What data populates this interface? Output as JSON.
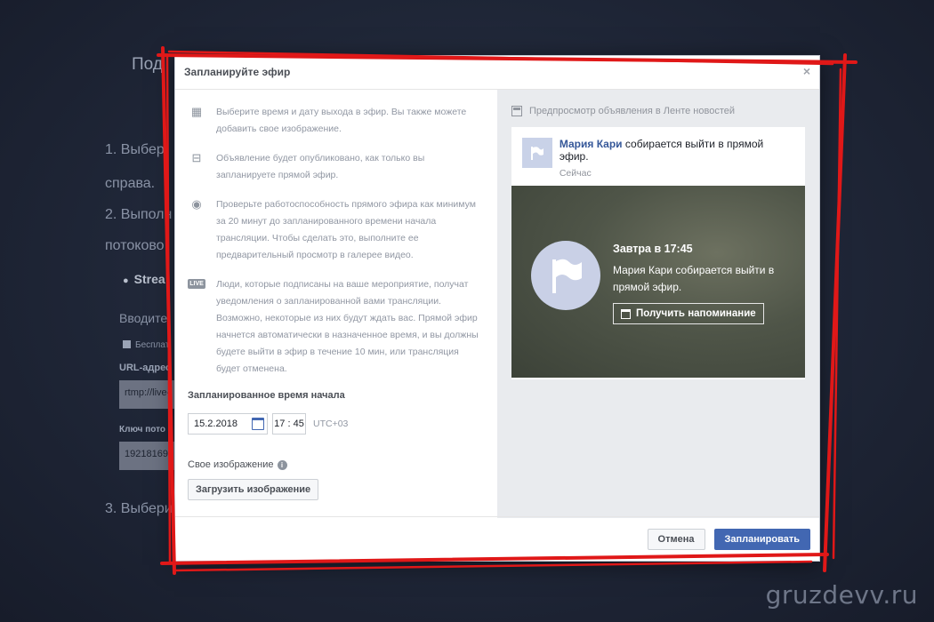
{
  "background": {
    "title": "Под",
    "line1": "1. Выбер",
    "line2": "справа.",
    "line3": "2. Выполн",
    "line4": "потоково",
    "stream_label": "Strea",
    "enter_label": "Вводите",
    "checkbox_label": "Бесплат",
    "url_label": "URL-адрес",
    "url_value": "rtmp://live-",
    "key_label": "Ключ пото",
    "key_value": "19218169",
    "line5": "3. Выбери"
  },
  "modal": {
    "title": "Запланируйте эфир",
    "close_label": "×",
    "info_items": [
      {
        "icon": "calendar-icon",
        "glyph": "▦",
        "text": "Выберите время и дату выхода в эфир. Вы также можете добавить свое изображение."
      },
      {
        "icon": "page-icon",
        "glyph": "⊟",
        "text": "Объявление будет опубликовано, как только вы запланируете прямой эфир."
      },
      {
        "icon": "eye-icon",
        "glyph": "◉",
        "text": "Проверьте работоспособность прямого эфира как минимум за 20 минут до запланированного времени начала трансляции. Чтобы сделать это, выполните ее предварительный просмотр в галерее видео."
      },
      {
        "icon": "live-badge-icon",
        "glyph": "LIVE",
        "text": "Люди, которые подписаны на ваше мероприятие, получат уведомления о запланированной вами трансляции. Возможно, некоторые из них будут ждать вас. Прямой эфир начнется автоматически в назначенное время, и вы должны будете выйти в эфир в течение 10 мин, или трансляция будет отменена."
      }
    ],
    "schedule_label": "Запланированное время начала",
    "date_value": "15.2.2018",
    "time_value": "17 : 45",
    "timezone": "UTC+03",
    "image_label": "Свое изображение",
    "info_glyph": "i",
    "upload_label": "Загрузить изображение",
    "preview": {
      "title": "Предпросмотр объявления в Ленте новостей",
      "author": "Мария Кари",
      "action": " собирается выйти в прямой эфир.",
      "time": "Сейчас",
      "when": "Завтра в 17:45",
      "message": "Мария Кари собирается выйти в прямой эфир.",
      "remind_label": "Получить напоминание"
    },
    "cancel_label": "Отмена",
    "submit_label": "Запланировать"
  },
  "watermark": "gruzdevv.ru",
  "colors": {
    "primary": "#4267b2",
    "link": "#365899",
    "annotation": "#e01818"
  }
}
